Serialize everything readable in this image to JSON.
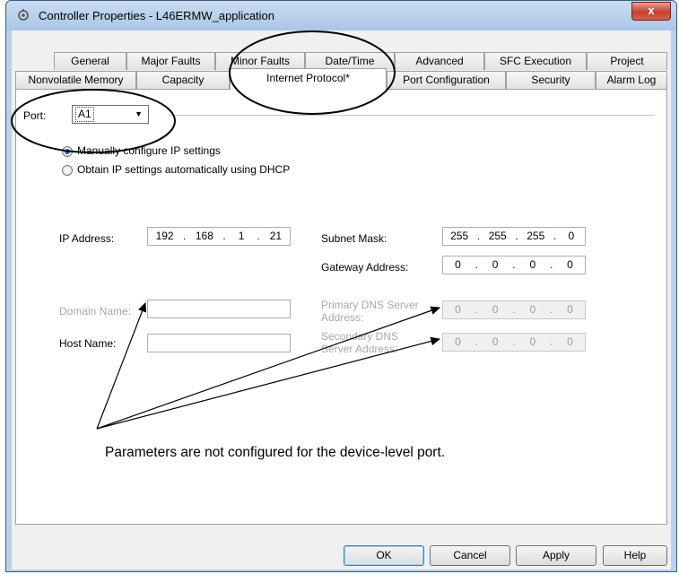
{
  "window": {
    "title": "Controller Properties - L46ERMW_application",
    "close_label": "x"
  },
  "tabs_row1": [
    "General",
    "Major Faults",
    "Minor Faults",
    "Date/Time",
    "Advanced",
    "SFC Execution",
    "Project"
  ],
  "tabs_row2": [
    "Nonvolatile Memory",
    "Capacity",
    "Internet Protocol*",
    "Port Configuration",
    "Security",
    "Alarm Log"
  ],
  "port": {
    "label": "Port:",
    "value": "A1"
  },
  "ip_mode": {
    "manual_label": "Manually configure IP settings",
    "dhcp_label": "Obtain IP settings automatically using DHCP",
    "selected": "manual"
  },
  "fields": {
    "ip_label": "IP Address:",
    "ip": [
      "192",
      "168",
      "1",
      "21"
    ],
    "subnet_label": "Subnet Mask:",
    "subnet": [
      "255",
      "255",
      "255",
      "0"
    ],
    "gateway_label": "Gateway Address:",
    "gateway": [
      "0",
      "0",
      "0",
      "0"
    ],
    "domain_label": "Domain Name:",
    "domain": "",
    "host_label": "Host Name:",
    "host": "",
    "dns1_label_line1": "Primary DNS Server",
    "dns1_label_line2": "Address:",
    "dns1": [
      "0",
      "0",
      "0",
      "0"
    ],
    "dns2_label_line1": "Secondary DNS",
    "dns2_label_line2": "Server Address:",
    "dns2": [
      "0",
      "0",
      "0",
      "0"
    ]
  },
  "annotation": "Parameters are not configured for the device-level port.",
  "buttons": {
    "ok": "OK",
    "cancel": "Cancel",
    "apply": "Apply",
    "help": "Help"
  }
}
